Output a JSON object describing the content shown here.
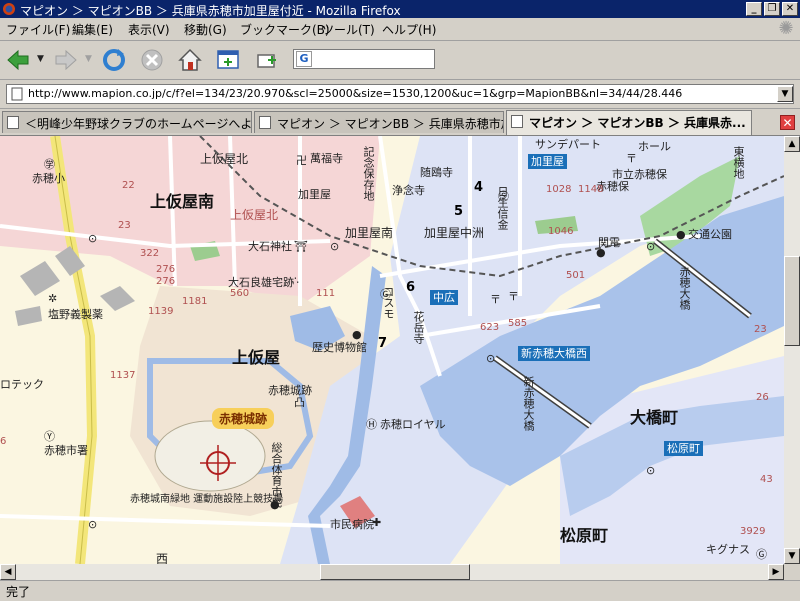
{
  "window": {
    "title": "マピオン ＞ マピオンBB ＞ 兵庫県赤穂市加里屋付近 - Mozilla Firefox",
    "min_label": "_",
    "max_label": "❐",
    "close_label": "✕"
  },
  "menubar": {
    "items": [
      "ファイル(F)",
      "編集(E)",
      "表示(V)",
      "移動(G)",
      "ブックマーク(B)",
      "ツール(T)",
      "ヘルプ(H)"
    ]
  },
  "toolbar": {
    "buttons": [
      "back-icon",
      "forward-icon",
      "reload-icon",
      "stop-icon",
      "home-icon",
      "new-tab-icon",
      "bookmark-add-icon"
    ],
    "search_icon_label": "G",
    "search_value": ""
  },
  "address": {
    "url": "http://www.mapion.co.jp/c/f?el=134/23/20.970&scl=25000&size=1530,1200&uc=1&grp=MapionBB&nl=34/44/28.446",
    "dropdown_label": "▼"
  },
  "tabs": [
    {
      "label": "＜明峰少年野球クラブのホームページへようこ...",
      "active": false
    },
    {
      "label": "マピオン ＞ マピオンBB ＞ 兵庫県赤穂市加...",
      "active": false
    },
    {
      "label": "マピオン ＞ マピオンBB ＞ 兵庫県赤...",
      "active": true
    }
  ],
  "tab_close_label": "✕",
  "map": {
    "area_labels": [
      "上仮屋南",
      "上仮屋",
      "大橋町",
      "松原町",
      "加里屋中洲",
      "上仮屋北",
      "加里屋南"
    ],
    "place_labels": [
      "赤穂小",
      "加里屋",
      "大石神社",
      "大石良雄宅跡",
      "塩野義製薬",
      "歴史博物館",
      "赤穂城跡",
      "赤穂市署",
      "赤穂ロイヤル",
      "市民病院",
      "赤穂城南緑地 運動施設陸上競技場",
      "萬福寺",
      "随鴎寺",
      "浄念寺",
      "市立赤穂保",
      "赤穂保",
      "関電",
      "交通公園",
      "サンデパート",
      "ホール",
      "キグナス",
      "東横地",
      "コスモ",
      "花岳寺",
      "赤穂大橋",
      "新赤穂大橋",
      "記念保存地",
      "日生信金",
      "総合体育市民",
      "上仮屋北",
      "ロテック",
      "西",
      "赤穂城跡"
    ],
    "station_tags": [
      "加里屋",
      "中広",
      "新赤穂大橋西",
      "松原町"
    ],
    "highlight_tag": "赤穂城跡",
    "block_numbers": [
      "4",
      "5",
      "6",
      "7"
    ],
    "numbers": [
      "22",
      "23",
      "322",
      "276",
      "276",
      "1181",
      "1139",
      "1137",
      "1148",
      "501",
      "623",
      "1028",
      "1046",
      "585",
      "560",
      "111",
      "23",
      "26",
      "3929",
      "6",
      "43"
    ]
  },
  "status": {
    "text": "完了"
  },
  "scroll": {
    "up": "▲",
    "down": "▼",
    "left": "◀",
    "right": "▶"
  }
}
